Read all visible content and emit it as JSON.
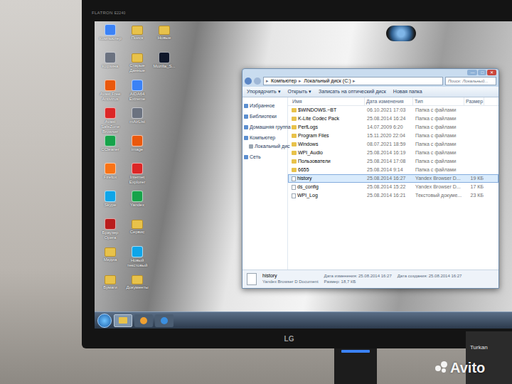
{
  "monitor": {
    "brand": "FLATRON",
    "model": "E2240",
    "logo": "LG"
  },
  "desktop": {
    "icons": [
      {
        "label": "Компьютер",
        "kind": "app"
      },
      {
        "label": "Корзина",
        "kind": "app"
      },
      {
        "label": "Avast Free Antivirus",
        "kind": "app"
      },
      {
        "label": "Avast SafeZone Browser",
        "kind": "app"
      },
      {
        "label": "CCleaner",
        "kind": "app"
      },
      {
        "label": "Firefox",
        "kind": "app"
      },
      {
        "label": "Skype",
        "kind": "app"
      },
      {
        "label": "Браузер Opera",
        "kind": "app"
      },
      {
        "label": "Медиа",
        "kind": "folder"
      },
      {
        "label": "Бумаги",
        "kind": "folder"
      },
      {
        "label": "Поиск",
        "kind": "folder"
      },
      {
        "label": "Старые Данные",
        "kind": "folder"
      },
      {
        "label": "AIDA64 Extreme",
        "kind": "app"
      },
      {
        "label": "mAirList",
        "kind": "app"
      },
      {
        "label": "image",
        "kind": "app"
      },
      {
        "label": "Internet Explorer",
        "kind": "app"
      },
      {
        "label": "Yandex",
        "kind": "app"
      },
      {
        "label": "Сервис",
        "kind": "folder"
      },
      {
        "label": "Новый текстовый",
        "kind": "app"
      },
      {
        "label": "Документы",
        "kind": "folder"
      },
      {
        "label": "Новые",
        "kind": "folder"
      },
      {
        "label": "Mozilla_S...",
        "kind": "app"
      }
    ]
  },
  "explorer": {
    "address": [
      "Компьютер",
      "Локальный диск (C:)"
    ],
    "separator": "▸",
    "search_placeholder": "Поиск: Локальный...",
    "window_controls": [
      "—",
      "□",
      "✕"
    ],
    "toolbar": [
      "Упорядочить ▾",
      "Открыть ▾",
      "Записать на оптический диск",
      "Новая папка"
    ],
    "nav": [
      {
        "label": "Избранное",
        "kind": "group"
      },
      {
        "label": "Библиотеки",
        "kind": "group"
      },
      {
        "label": "Домашняя группа",
        "kind": "group"
      },
      {
        "label": "Компьютер",
        "kind": "group"
      },
      {
        "label": "Локальный дис",
        "kind": "item"
      },
      {
        "label": "Сеть",
        "kind": "group"
      }
    ],
    "columns": [
      "Имя",
      "Дата изменения",
      "Тип",
      "Размер"
    ],
    "rows": [
      {
        "name": "$WINDOWS.~BT",
        "date": "06.10.2021 17:03",
        "type": "Папка с файлами",
        "size": "",
        "kind": "folder",
        "selected": false
      },
      {
        "name": "K-Lite Codec Pack",
        "date": "25.08.2014 16:24",
        "type": "Папка с файлами",
        "size": "",
        "kind": "folder",
        "selected": false
      },
      {
        "name": "PerfLogs",
        "date": "14.07.2009 6:20",
        "type": "Папка с файлами",
        "size": "",
        "kind": "folder",
        "selected": false
      },
      {
        "name": "Program Files",
        "date": "15.11.2020 22:04",
        "type": "Папка с файлами",
        "size": "",
        "kind": "folder",
        "selected": false
      },
      {
        "name": "Windows",
        "date": "08.07.2021 18:59",
        "type": "Папка с файлами",
        "size": "",
        "kind": "folder",
        "selected": false
      },
      {
        "name": "WPI_Audio",
        "date": "25.08.2014 16:19",
        "type": "Папка с файлами",
        "size": "",
        "kind": "folder",
        "selected": false
      },
      {
        "name": "Пользователи",
        "date": "25.08.2014 17:08",
        "type": "Папка с файлами",
        "size": "",
        "kind": "folder",
        "selected": false
      },
      {
        "name": "6655",
        "date": "25.08.2014 9:14",
        "type": "Папка с файлами",
        "size": "",
        "kind": "folder",
        "selected": false
      },
      {
        "name": "history",
        "date": "25.08.2014 16:27",
        "type": "Yandex Browser D...",
        "size": "19 КБ",
        "kind": "file",
        "selected": true
      },
      {
        "name": "ds_config",
        "date": "25.08.2014 15:22",
        "type": "Yandex Browser D...",
        "size": "17 КБ",
        "kind": "file",
        "selected": false
      },
      {
        "name": "WPI_Log",
        "date": "25.08.2014 16:21",
        "type": "Текстовый докуме...",
        "size": "23 КБ",
        "kind": "file",
        "selected": false
      }
    ],
    "details": {
      "name": "history",
      "type": "Yandex Browser D Document",
      "modified": "Дата изменения: 25.08.2014 16:27",
      "size": "Размер: 18,7 КБ",
      "created": "Дата создания: 25.08.2014 16:27"
    }
  },
  "box_label": "Turkan",
  "watermark": "Avito"
}
